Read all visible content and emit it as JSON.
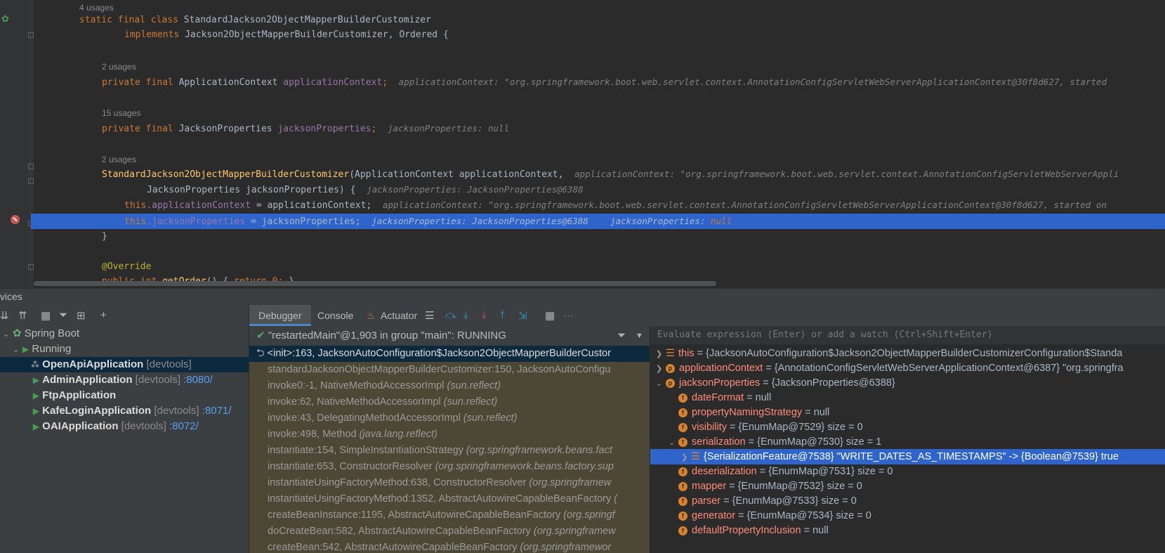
{
  "editor": {
    "usages_1": "4 usages",
    "class_decl": {
      "kw": "static final class",
      "name": "StandardJackson2ObjectMapperBuilderCustomizer"
    },
    "implements_line": {
      "kw": "implements",
      "types": "Jackson2ObjectMapperBuilderCustomizer, Ordered {"
    },
    "usages_2": "2 usages",
    "field1": {
      "kw": "private final",
      "type": "ApplicationContext",
      "name": "applicationContext",
      "semi": ";",
      "hint": "applicationContext: \"org.springframework.boot.web.servlet.context.AnnotationConfigServletWebServerApplicationContext@30f8d627, started"
    },
    "usages_3": "15 usages",
    "field2": {
      "kw": "private final",
      "type": "JacksonProperties",
      "name": "jacksonProperties",
      "semi": ";",
      "hint": "jacksonProperties: null"
    },
    "usages_4": "2 usages",
    "ctor": {
      "name": "StandardJackson2ObjectMapperBuilderCustomizer",
      "params": "(ApplicationContext applicationContext,",
      "hint": "applicationContext: \"org.springframework.boot.web.servlet.context.AnnotationConfigServletWebServerAppli"
    },
    "ctor2": {
      "params": "JacksonProperties jacksonProperties) {",
      "hint": "jacksonProperties: JacksonProperties@6388"
    },
    "assign1": {
      "this": "this",
      "field": ".applicationContext",
      "rest": " = applicationContext;",
      "hint": "applicationContext: \"org.springframework.boot.web.servlet.context.AnnotationConfigServletWebServerApplicationContext@30f8d627, started on"
    },
    "assign2": {
      "this": "this",
      "field": ".jacksonProperties",
      "rest": " = jacksonProperties;",
      "hint1": "jacksonProperties: JacksonProperties@6388",
      "hint2_label": "jacksonProperties: ",
      "hint2_value": "null"
    },
    "close_brace": "}",
    "override": "@Override",
    "get_order": {
      "kw": "public int",
      "name": "getOrder",
      "rest": "() { ",
      "ret": "return 0;",
      "end": " }"
    }
  },
  "services": {
    "title": "vices"
  },
  "services_tree": {
    "root": "Spring Boot",
    "group": "Running",
    "apps": [
      {
        "name": "OpenApiApplication",
        "tag": "[devtools]",
        "port": ""
      },
      {
        "name": "AdminApplication",
        "tag": "[devtools]",
        "port": ":8080/"
      },
      {
        "name": "FtpApplication",
        "tag": "",
        "port": ""
      },
      {
        "name": "KafeLoginApplication",
        "tag": "[devtools]",
        "port": ":8071/"
      },
      {
        "name": "OAIApplication",
        "tag": "[devtools]",
        "port": ":8072/"
      }
    ]
  },
  "debugger": {
    "tabs": {
      "debugger": "Debugger",
      "console": "Console",
      "actuator": "Actuator"
    },
    "thread": "\"restartedMain\"@1,903 in group \"main\": RUNNING",
    "frames": [
      {
        "method": "<init>:163, JacksonAutoConfiguration$Jackson2ObjectMapperBuilderCustor",
        "pkg": ""
      },
      {
        "method": "standardJacksonObjectMapperBuilderCustomizer:150, JacksonAutoConfigu",
        "pkg": ""
      },
      {
        "method": "invoke0:-1, NativeMethodAccessorImpl ",
        "pkg": "(sun.reflect)"
      },
      {
        "method": "invoke:62, NativeMethodAccessorImpl ",
        "pkg": "(sun.reflect)"
      },
      {
        "method": "invoke:43, DelegatingMethodAccessorImpl ",
        "pkg": "(sun.reflect)"
      },
      {
        "method": "invoke:498, Method ",
        "pkg": "(java.lang.reflect)"
      },
      {
        "method": "instantiate:154, SimpleInstantiationStrategy ",
        "pkg": "(org.springframework.beans.fact"
      },
      {
        "method": "instantiate:653, ConstructorResolver ",
        "pkg": "(org.springframework.beans.factory.sup"
      },
      {
        "method": "instantiateUsingFactoryMethod:638, ConstructorResolver ",
        "pkg": "(org.springframew"
      },
      {
        "method": "instantiateUsingFactoryMethod:1352, AbstractAutowireCapableBeanFactory ",
        "pkg": "("
      },
      {
        "method": "createBeanInstance:1195, AbstractAutowireCapableBeanFactory ",
        "pkg": "(org.springf"
      },
      {
        "method": "doCreateBean:582, AbstractAutowireCapableBeanFactory ",
        "pkg": "(org.springframew"
      },
      {
        "method": "createBean:542, AbstractAutowireCapableBeanFactory ",
        "pkg": "(org.springframewor"
      }
    ],
    "eval_placeholder": "Evaluate expression (Enter) or add a watch (Ctrl+Shift+Enter)",
    "variables": [
      {
        "name": "this",
        "value": " = {JacksonAutoConfiguration$Jackson2ObjectMapperBuilderCustomizerConfiguration$Standa",
        "size": ""
      },
      {
        "name": "applicationContext",
        "value": " = {AnnotationConfigServletWebServerApplicationContext@6387} \"org.springfra",
        "size": ""
      },
      {
        "name": "jacksonProperties",
        "value": " = {JacksonProperties@6388}",
        "size": ""
      },
      {
        "name": "dateFormat",
        "value": " = null",
        "size": ""
      },
      {
        "name": "propertyNamingStrategy",
        "value": " = null",
        "size": ""
      },
      {
        "name": "visibility",
        "value": " = {EnumMap@7529}",
        "size": "  size = 0"
      },
      {
        "name": "serialization",
        "value": " = {EnumMap@7530}",
        "size": "  size = 1"
      },
      {
        "name": "",
        "value": "{SerializationFeature@7538} \"WRITE_DATES_AS_TIMESTAMPS\" -> {Boolean@7539} true",
        "size": ""
      },
      {
        "name": "deserialization",
        "value": " = {EnumMap@7531}",
        "size": "  size = 0"
      },
      {
        "name": "mapper",
        "value": " = {EnumMap@7532}",
        "size": "  size = 0"
      },
      {
        "name": "parser",
        "value": " = {EnumMap@7533}",
        "size": "  size = 0"
      },
      {
        "name": "generator",
        "value": " = {EnumMap@7534}",
        "size": "  size = 0"
      },
      {
        "name": "defaultPropertyInclusion",
        "value": " = null",
        "size": ""
      }
    ]
  },
  "colors": {
    "accent": "#2f65ca",
    "keyword": "#cc7832",
    "field": "#9876aa",
    "function": "#ffc66d"
  }
}
